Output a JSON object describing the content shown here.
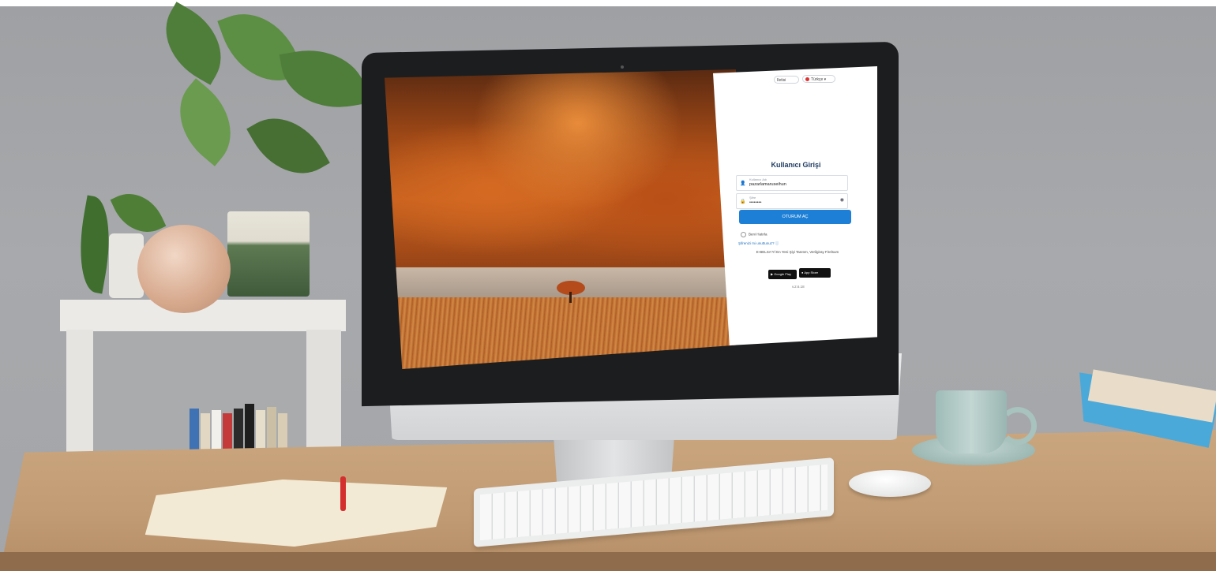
{
  "login": {
    "top_pill_left": "Iletisi",
    "language": "Türkçe",
    "title": "Kullanıcı Girişi",
    "username_label": "Kullanıcı Adı",
    "username_value": "pazarlamaruseihun",
    "password_label": "Şifre",
    "password_value": "••••••••",
    "login_button": "OTURUM AÇ",
    "remember_me": "Beni Hatırla",
    "forgot_password": "Şifrenizi mi unuttunuz?",
    "app_promo": "E-BELSA'Yİ En Yeni Şiyi Tanıtım, Verilgiray Firelsum",
    "google_play": "Google Play",
    "app_store": "App Store",
    "version": "v.2.6.18"
  },
  "colors": {
    "accent": "#1d7fd6",
    "title": "#1f3b63",
    "sky": "#c9621f",
    "desk": "#c19b73"
  }
}
